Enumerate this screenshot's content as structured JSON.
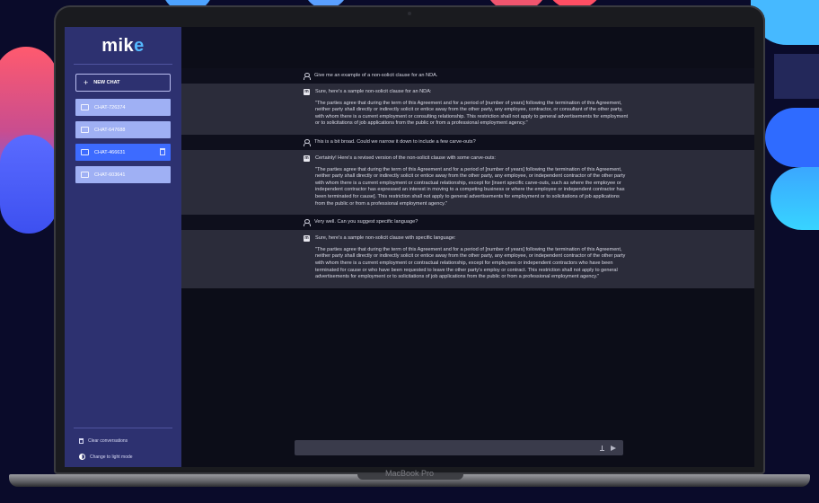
{
  "device": {
    "brand": "MacBook Pro"
  },
  "app": {
    "logo_main": "mik",
    "logo_accent": "e"
  },
  "sidebar": {
    "new_chat_icon": "+",
    "new_chat_label": "NEW CHAT",
    "chats": [
      {
        "label": "CHAT-726374"
      },
      {
        "label": "CHAT-647688"
      },
      {
        "label": "CHAT-466631"
      },
      {
        "label": "CHAT-603641"
      }
    ],
    "active_chat_index": 2,
    "clear_label": "Clear conversations",
    "mode_label": "Change to light mode"
  },
  "messages": [
    {
      "role": "user",
      "text": "Give me an example of a non-solicit clause for an NDA."
    },
    {
      "role": "bot",
      "intro": "Sure, here's a sample non-solicit clause for an NDA:",
      "quote": "\"The parties agree that during the term of this Agreement and for a period of [number of years] following the termination of this Agreement, neither party shall directly or indirectly solicit or entice away from the other party, any employee, contractor, or consultant of the other party, with whom there is a current employment or consulting relationship. This restriction shall not apply to general advertisements for employment or to solicitations of job applications from the public or from a professional employment agency.\""
    },
    {
      "role": "user",
      "text": "This is a bit broad. Could we narrow it down to include a few carve-outs?"
    },
    {
      "role": "bot",
      "intro": "Certainly! Here's a revised version of the non-solicit clause with some carve-outs:",
      "quote": "\"The parties agree that during the term of this Agreement and for a period of [number of years] following the termination of this Agreement, neither party shall directly or indirectly solicit or entice away from the other party, any employee, or independent contractor of the other party with whom there is a current employment or contractual relationship, except for [insert specific carve-outs, such as where the employee or independent contractor has expressed an interest in moving to a competing business or where the employee or independent contractor has been terminated for cause]. This restriction shall not apply to general advertisements for employment or to solicitations of job applications from the public or from a professional employment agency.\""
    },
    {
      "role": "user",
      "text": "Very well. Can you suggest specific language?"
    },
    {
      "role": "bot",
      "intro": "Sure, here's a sample non-solicit clause with specific language:",
      "quote": "\"The parties agree that during the term of this Agreement and for a period of [number of years] following the termination of this Agreement, neither party shall directly or indirectly solicit or entice away from the other party, any employee, or independent contractor of the other party with whom there is a current employment or contractual relationship, except for employees or independent contractors who have been terminated for cause or who have been requested to leave the other party's employ or contract. This restriction shall not apply to general advertisements for employment or to solicitations of job applications from the public or from a professional employment agency.\""
    }
  ],
  "input": {
    "value": ""
  },
  "icons": {
    "user": "user-icon",
    "bot": "bot-icon",
    "bot_glyph": "m",
    "chat": "chat-bubble-icon",
    "trash": "trash-icon",
    "upload": "upload-icon",
    "send": "send-icon",
    "mode": "half-circle-icon"
  },
  "colors": {
    "sidebar": "#2d3170",
    "chat_item": "#9fb0f4",
    "chat_active": "#3d6bff",
    "accent": "#54b9ff"
  }
}
